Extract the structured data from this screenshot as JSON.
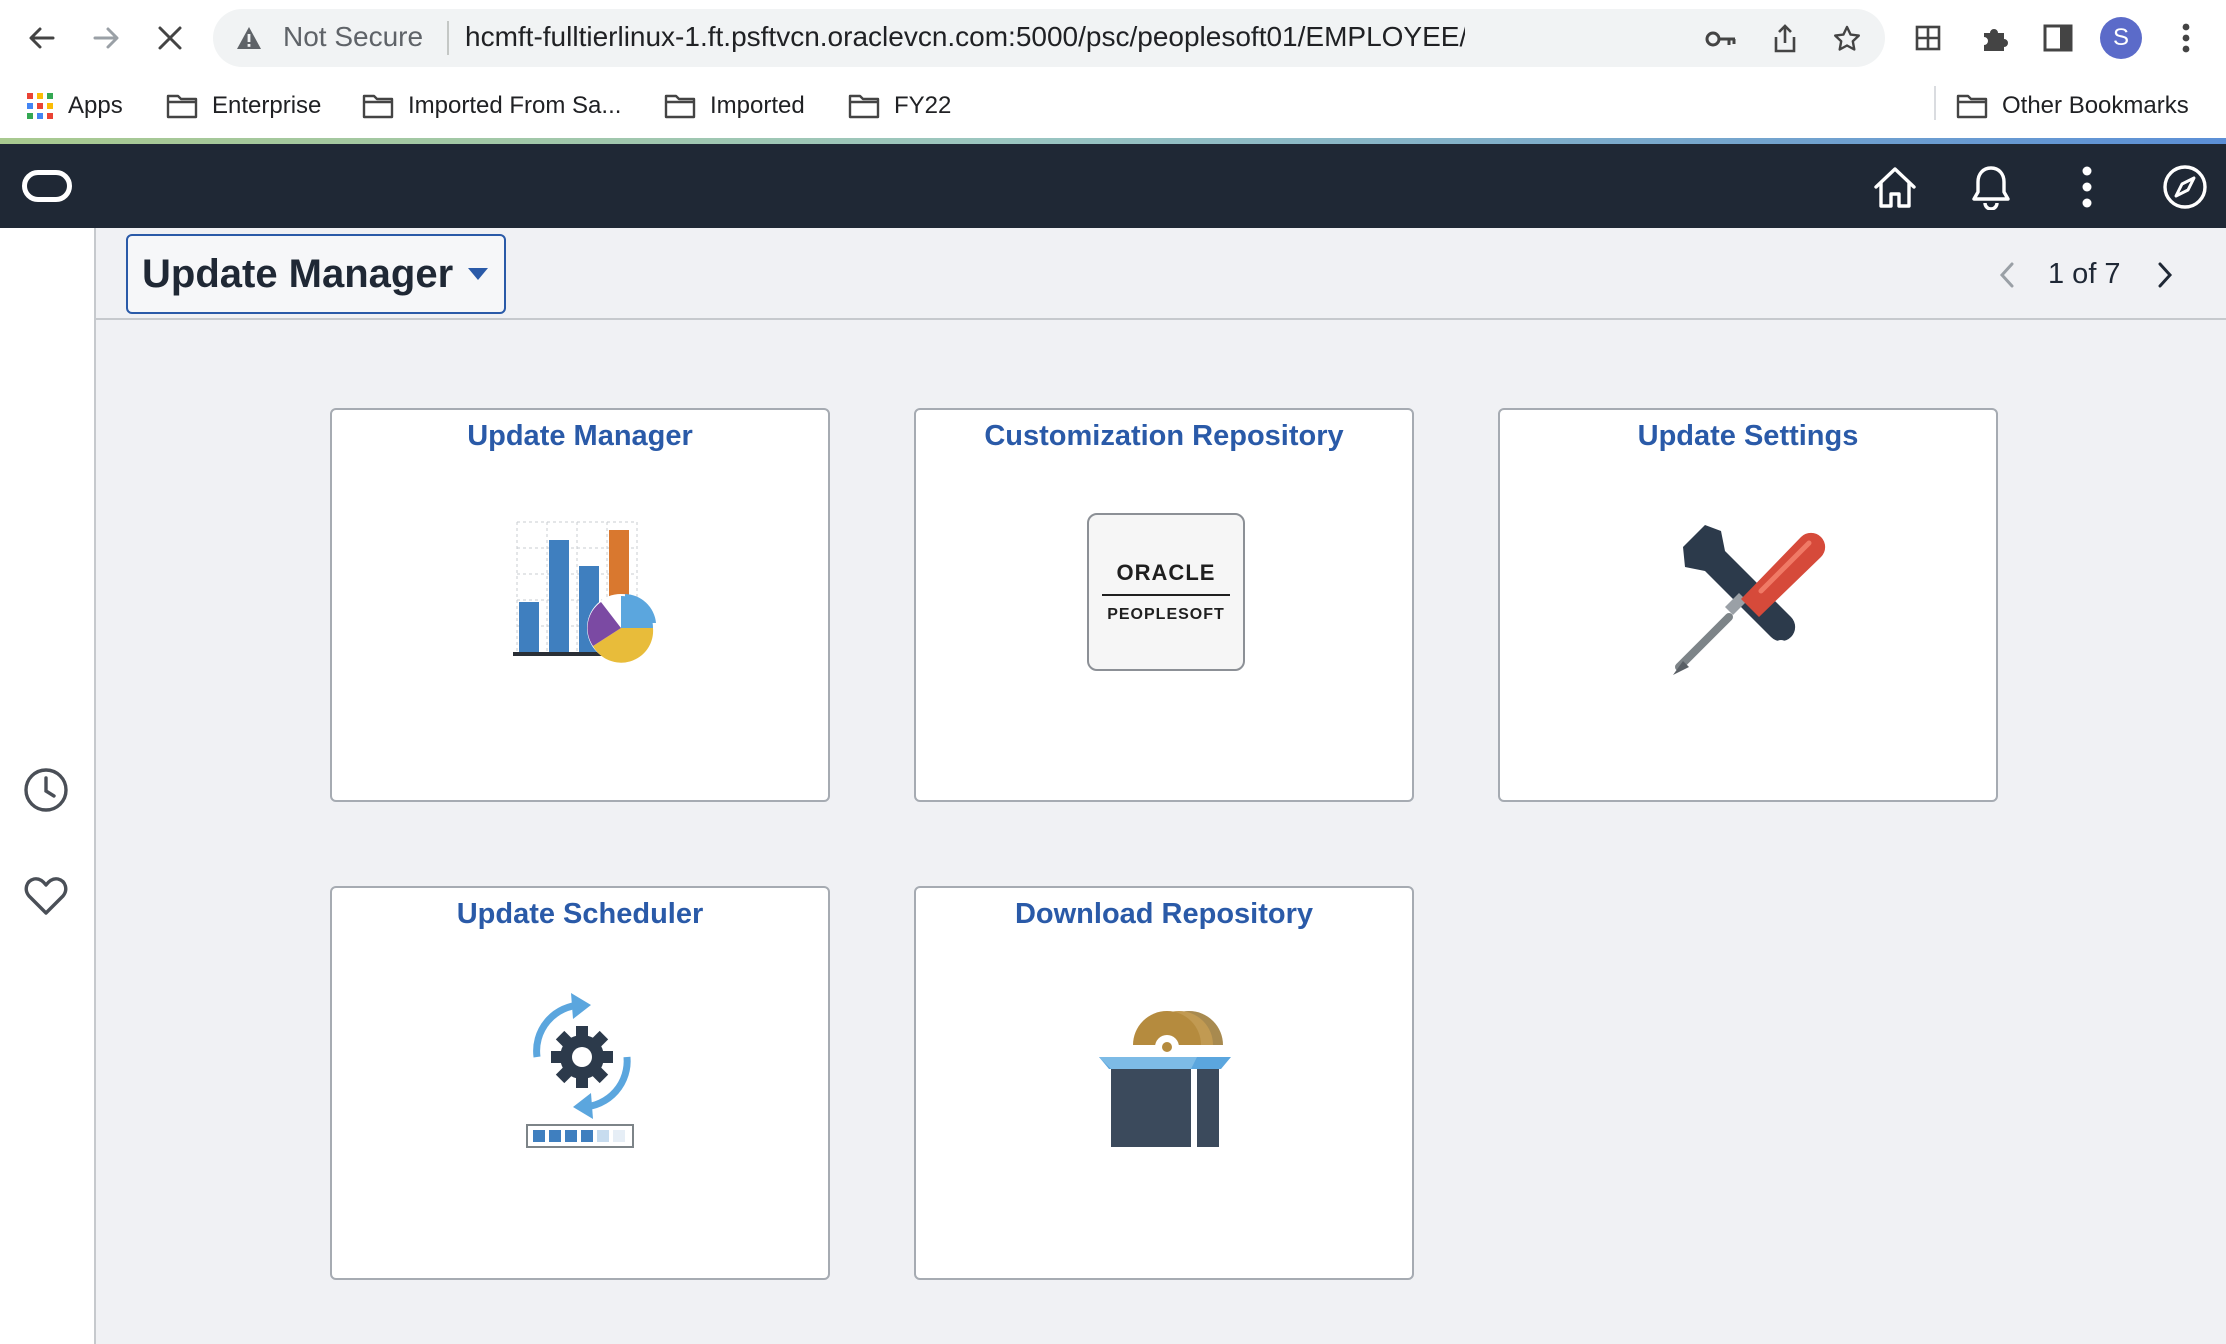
{
  "browser": {
    "security_label": "Not Secure",
    "url": "hcmft-fulltierlinux-1.ft.psftvcn.oraclevcn.com:5000/psc/peoplesoft01/EMPLOYEE/HRMS/c/...",
    "profile_initial": "S"
  },
  "bookmarks": {
    "apps": "Apps",
    "items": [
      "Enterprise",
      "Imported From Sa...",
      "Imported",
      "FY22"
    ],
    "other": "Other Bookmarks"
  },
  "header": {
    "title": "Update Manager",
    "pager": "1 of 7"
  },
  "tiles": [
    {
      "title": "Update Manager",
      "icon": "bar-pie-chart-icon"
    },
    {
      "title": "Customization Repository",
      "icon": "oracle-peoplesoft-logo"
    },
    {
      "title": "Update Settings",
      "icon": "wrench-screwdriver-icon"
    },
    {
      "title": "Update Scheduler",
      "icon": "gear-refresh-icon"
    },
    {
      "title": "Download Repository",
      "icon": "disc-box-icon"
    }
  ],
  "logo_text": {
    "oracle": "ORACLE",
    "peoplesoft": "PEOPLESOFT"
  },
  "colors": {
    "banner": "#1f2835",
    "tile_title": "#2a5aa8",
    "content_bg": "#f0f1f4"
  }
}
